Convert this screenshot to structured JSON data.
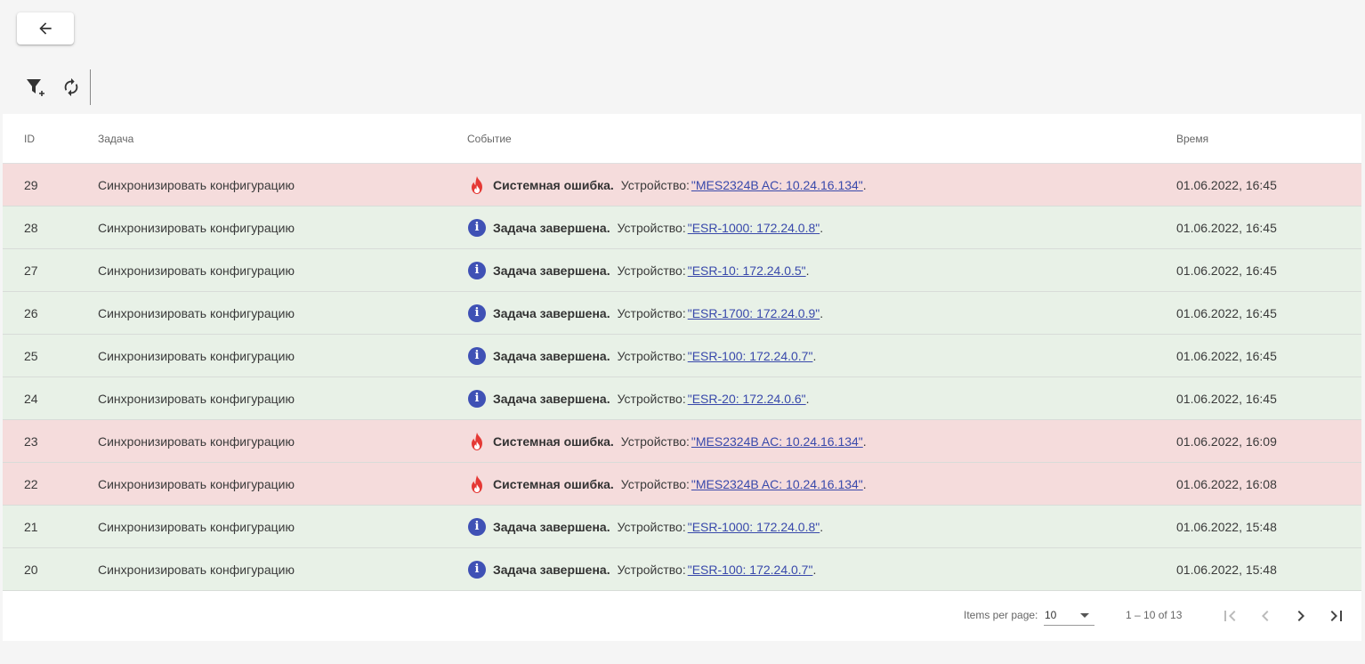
{
  "header": {
    "back_icon": "arrow-left-icon"
  },
  "toolbar": {
    "filter_icon": "filter-add-icon",
    "refresh_icon": "refresh-icon"
  },
  "colors": {
    "error_row": "#f5dcdc",
    "info_row": "#e8f1e7",
    "info_icon": "#3f51b5",
    "error_icon": "#e53935",
    "link": "#3949ab"
  },
  "table": {
    "columns": {
      "id": "ID",
      "task": "Задача",
      "event": "Событие",
      "time": "Время"
    },
    "rows": [
      {
        "id": "29",
        "task": "Синхронизировать конфигурацию",
        "type": "error",
        "status": "Системная ошибка.",
        "device_label": "Устройство:",
        "device": "\"MES2324B AC: 10.24.16.134\"",
        "suffix": ".",
        "time": "01.06.2022, 16:45"
      },
      {
        "id": "28",
        "task": "Синхронизировать конфигурацию",
        "type": "info",
        "status": "Задача завершена.",
        "device_label": "Устройство:",
        "device": "\"ESR-1000: 172.24.0.8\"",
        "suffix": ".",
        "time": "01.06.2022, 16:45"
      },
      {
        "id": "27",
        "task": "Синхронизировать конфигурацию",
        "type": "info",
        "status": "Задача завершена.",
        "device_label": "Устройство:",
        "device": "\"ESR-10: 172.24.0.5\"",
        "suffix": ".",
        "time": "01.06.2022, 16:45"
      },
      {
        "id": "26",
        "task": "Синхронизировать конфигурацию",
        "type": "info",
        "status": "Задача завершена.",
        "device_label": "Устройство:",
        "device": "\"ESR-1700: 172.24.0.9\"",
        "suffix": ".",
        "time": "01.06.2022, 16:45"
      },
      {
        "id": "25",
        "task": "Синхронизировать конфигурацию",
        "type": "info",
        "status": "Задача завершена.",
        "device_label": "Устройство:",
        "device": "\"ESR-100: 172.24.0.7\"",
        "suffix": ".",
        "time": "01.06.2022, 16:45"
      },
      {
        "id": "24",
        "task": "Синхронизировать конфигурацию",
        "type": "info",
        "status": "Задача завершена.",
        "device_label": "Устройство:",
        "device": "\"ESR-20: 172.24.0.6\"",
        "suffix": ".",
        "time": "01.06.2022, 16:45"
      },
      {
        "id": "23",
        "task": "Синхронизировать конфигурацию",
        "type": "error",
        "status": "Системная ошибка.",
        "device_label": "Устройство:",
        "device": "\"MES2324B AC: 10.24.16.134\"",
        "suffix": ".",
        "time": "01.06.2022, 16:09"
      },
      {
        "id": "22",
        "task": "Синхронизировать конфигурацию",
        "type": "error",
        "status": "Системная ошибка.",
        "device_label": "Устройство:",
        "device": "\"MES2324B AC: 10.24.16.134\"",
        "suffix": ".",
        "time": "01.06.2022, 16:08"
      },
      {
        "id": "21",
        "task": "Синхронизировать конфигурацию",
        "type": "info",
        "status": "Задача завершена.",
        "device_label": "Устройство:",
        "device": "\"ESR-1000: 172.24.0.8\"",
        "suffix": ".",
        "time": "01.06.2022, 15:48"
      },
      {
        "id": "20",
        "task": "Синхронизировать конфигурацию",
        "type": "info",
        "status": "Задача завершена.",
        "device_label": "Устройство:",
        "device": "\"ESR-100: 172.24.0.7\"",
        "suffix": ".",
        "time": "01.06.2022, 15:48"
      }
    ]
  },
  "paginator": {
    "items_per_page_label": "Items per page:",
    "page_size": "10",
    "range": "1 – 10 of 13",
    "first_icon": "first-page-icon",
    "prev_icon": "chevron-left-icon",
    "next_icon": "chevron-right-icon",
    "last_icon": "last-page-icon"
  }
}
